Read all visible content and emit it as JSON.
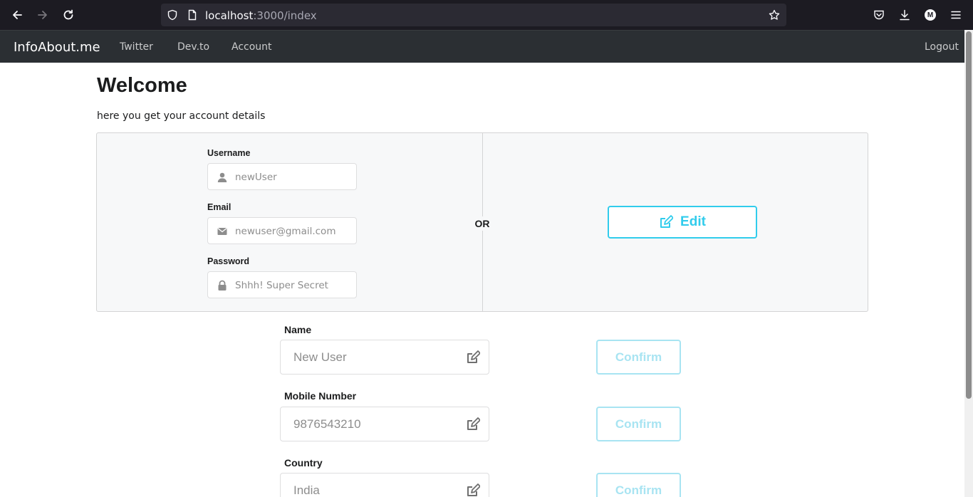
{
  "browser": {
    "url_host": "localhost",
    "url_path": ":3000/index",
    "profile_initial": "M"
  },
  "navbar": {
    "brand": "InfoAbout.me",
    "links": [
      "Twitter",
      "Dev.to",
      "Account"
    ],
    "logout": "Logout"
  },
  "main": {
    "title": "Welcome",
    "subtitle": "here you get your account details",
    "or_label": "OR",
    "edit_label": "Edit",
    "credentials": {
      "username_label": "Username",
      "username_placeholder": "newUser",
      "email_label": "Email",
      "email_placeholder": "newuser@gmail.com",
      "password_label": "Password",
      "password_placeholder": "Shhh! Super Secret"
    },
    "details": [
      {
        "label": "Name",
        "value": "New User",
        "button": "Confirm"
      },
      {
        "label": "Mobile Number",
        "value": "9876543210",
        "button": "Confirm"
      },
      {
        "label": "Country",
        "value": "India",
        "button": "Confirm"
      }
    ]
  },
  "colors": {
    "accent": "#31ccec",
    "accent_disabled": "#a8e4f2",
    "navbar_bg": "#2b2f33"
  },
  "icons": {
    "back": "arrow-left-icon",
    "forward": "arrow-right-icon",
    "reload": "reload-icon",
    "shield": "shield-icon",
    "page": "page-icon",
    "star": "star-icon",
    "pocket": "pocket-icon",
    "download": "download-icon",
    "menu": "hamburger-menu-icon",
    "user": "user-icon",
    "mail": "envelope-icon",
    "lock": "lock-icon",
    "edit": "edit-icon"
  }
}
